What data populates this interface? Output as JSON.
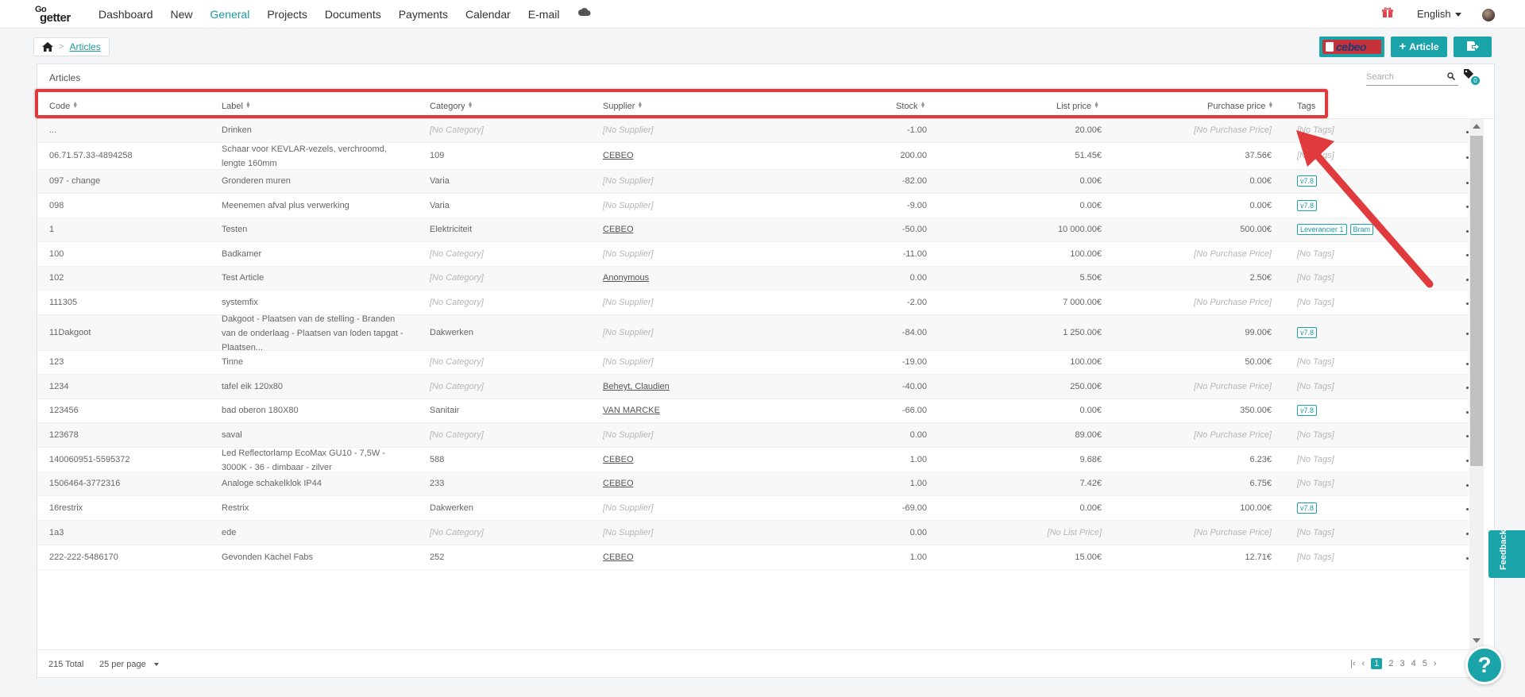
{
  "app": {
    "logo_top": "Go",
    "logo_bottom": "getter"
  },
  "nav": {
    "items": [
      "Dashboard",
      "New",
      "General",
      "Projects",
      "Documents",
      "Payments",
      "Calendar",
      "E-mail"
    ],
    "active_index": 2
  },
  "header": {
    "language": "English"
  },
  "breadcrumb": {
    "current": "Articles"
  },
  "actions": {
    "cebeo_label": "cebeo",
    "add_label": "Article"
  },
  "card": {
    "title": "Articles",
    "search_placeholder": "Search",
    "tag_filter_count": "0"
  },
  "columns": {
    "code": "Code",
    "label": "Label",
    "category": "Category",
    "supplier": "Supplier",
    "stock": "Stock",
    "list_price": "List price",
    "purchase_price": "Purchase price",
    "tags": "Tags"
  },
  "rows": [
    {
      "code": "...",
      "label": "Drinken",
      "category": "[No Category]",
      "supplier": "[No Supplier]",
      "stock": "-1.00",
      "list_price": "20.00€",
      "purchase_price": "[No Purchase Price]",
      "tags": [],
      "tags_empty": "[No Tags]"
    },
    {
      "code": "06.71.57.33-4894258",
      "label": "Schaar voor KEVLAR-vezels, verchroomd, lengte 160mm",
      "category": "109",
      "supplier": "CEBEO",
      "stock": "200.00",
      "list_price": "51.45€",
      "purchase_price": "37.56€",
      "tags": [],
      "tags_empty": "[No Tags]"
    },
    {
      "code": "097 - change",
      "label": "Gronderen muren",
      "category": "Varia",
      "supplier": "[No Supplier]",
      "stock": "-82.00",
      "list_price": "0.00€",
      "purchase_price": "0.00€",
      "tags": [
        "v7.8"
      ],
      "tags_empty": ""
    },
    {
      "code": "098",
      "label": "Meenemen afval plus verwerking",
      "category": "Varia",
      "supplier": "[No Supplier]",
      "stock": "-9.00",
      "list_price": "0.00€",
      "purchase_price": "0.00€",
      "tags": [
        "v7.8"
      ],
      "tags_empty": ""
    },
    {
      "code": "1",
      "label": "Testen",
      "category": "Elektriciteit",
      "supplier": "CEBEO",
      "stock": "-50.00",
      "list_price": "10 000.00€",
      "purchase_price": "500.00€",
      "tags": [
        "Leverancier 1",
        "Bram"
      ],
      "tags_empty": ""
    },
    {
      "code": "100",
      "label": "Badkamer",
      "category": "[No Category]",
      "supplier": "[No Supplier]",
      "stock": "-11.00",
      "list_price": "100.00€",
      "purchase_price": "[No Purchase Price]",
      "tags": [],
      "tags_empty": "[No Tags]"
    },
    {
      "code": "102",
      "label": "Test Article",
      "category": "[No Category]",
      "supplier": "Anonymous",
      "stock": "0.00",
      "list_price": "5.50€",
      "purchase_price": "2.50€",
      "tags": [],
      "tags_empty": "[No Tags]"
    },
    {
      "code": "111305",
      "label": "systemfix",
      "category": "[No Category]",
      "supplier": "[No Supplier]",
      "stock": "-2.00",
      "list_price": "7 000.00€",
      "purchase_price": "[No Purchase Price]",
      "tags": [],
      "tags_empty": "[No Tags]"
    },
    {
      "code": "11Dakgoot",
      "label": "Dakgoot - Plaatsen van de stelling - Branden van de onderlaag - Plaatsen van loden tapgat - Plaatsen...",
      "category": "Dakwerken",
      "supplier": "[No Supplier]",
      "stock": "-84.00",
      "list_price": "1 250.00€",
      "purchase_price": "99.00€",
      "tags": [
        "v7.8"
      ],
      "tags_empty": ""
    },
    {
      "code": "123",
      "label": "Tinne",
      "category": "[No Category]",
      "supplier": "[No Supplier]",
      "stock": "-19.00",
      "list_price": "100.00€",
      "purchase_price": "50.00€",
      "tags": [],
      "tags_empty": "[No Tags]"
    },
    {
      "code": "1234",
      "label": "tafel eik 120x80",
      "category": "[No Category]",
      "supplier": "Beheyt, Claudien",
      "stock": "-40.00",
      "list_price": "250.00€",
      "purchase_price": "[No Purchase Price]",
      "tags": [],
      "tags_empty": "[No Tags]"
    },
    {
      "code": "123456",
      "label": "bad oberon 180X80",
      "category": "Sanitair",
      "supplier": "VAN MARCKE",
      "stock": "-66.00",
      "list_price": "0.00€",
      "purchase_price": "350.00€",
      "tags": [
        "v7.8"
      ],
      "tags_empty": ""
    },
    {
      "code": "123678",
      "label": "saval",
      "category": "[No Category]",
      "supplier": "[No Supplier]",
      "stock": "0.00",
      "list_price": "89.00€",
      "purchase_price": "[No Purchase Price]",
      "tags": [],
      "tags_empty": "[No Tags]"
    },
    {
      "code": "140060951-5595372",
      "label": "Led Reflectorlamp EcoMax GU10 - 7,5W - 3000K - 36 - dimbaar - zilver",
      "category": "588",
      "supplier": "CEBEO",
      "stock": "1.00",
      "list_price": "9.68€",
      "purchase_price": "6.23€",
      "tags": [],
      "tags_empty": "[No Tags]"
    },
    {
      "code": "1506464-3772316",
      "label": "Analoge schakelklok IP44",
      "category": "233",
      "supplier": "CEBEO",
      "stock": "1.00",
      "list_price": "7.42€",
      "purchase_price": "6.75€",
      "tags": [],
      "tags_empty": "[No Tags]"
    },
    {
      "code": "16restrix",
      "label": "Restrix",
      "category": "Dakwerken",
      "supplier": "[No Supplier]",
      "stock": "-69.00",
      "list_price": "0.00€",
      "purchase_price": "100.00€",
      "tags": [
        "v7.8"
      ],
      "tags_empty": ""
    },
    {
      "code": "1a3",
      "label": "ede",
      "category": "[No Category]",
      "supplier": "[No Supplier]",
      "stock": "0.00",
      "list_price": "[No List Price]",
      "purchase_price": "[No Purchase Price]",
      "tags": [],
      "tags_empty": "[No Tags]"
    },
    {
      "code": "222-222-5486170",
      "label": "Gevonden Kachel Fabs",
      "category": "252",
      "supplier": "CEBEO",
      "stock": "1.00",
      "list_price": "15.00€",
      "purchase_price": "12.71€",
      "tags": [],
      "tags_empty": "[No Tags]"
    }
  ],
  "footer": {
    "total": "215 Total",
    "per_page": "25 per page",
    "pages": [
      "1",
      "2",
      "3",
      "4",
      "5"
    ],
    "current_page": "1"
  },
  "feedback_label": "Feedback",
  "help_label": "?"
}
